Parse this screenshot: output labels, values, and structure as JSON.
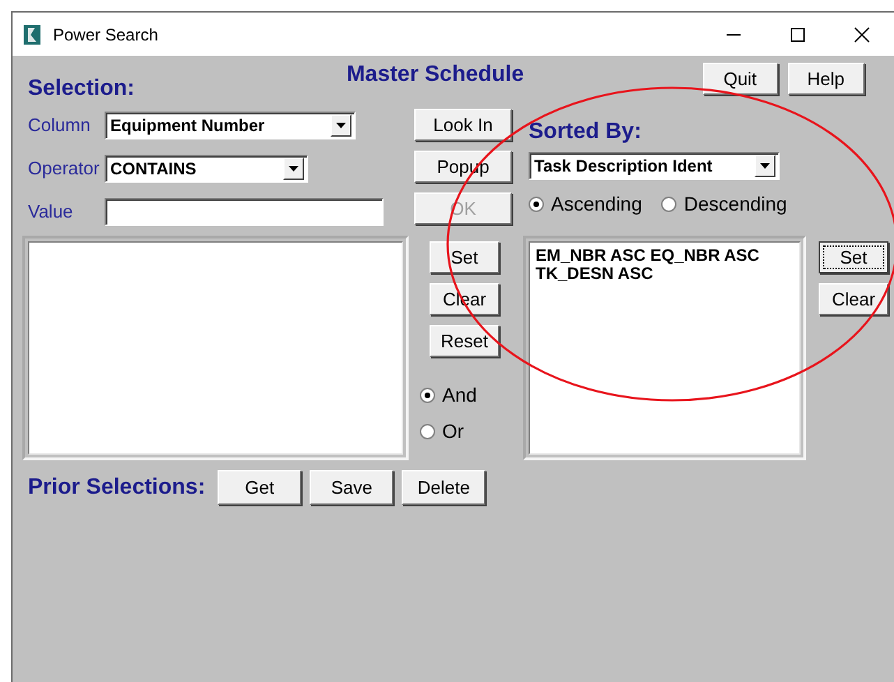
{
  "window": {
    "title": "Power Search"
  },
  "title": "Master Schedule",
  "top_buttons": [
    "Quit",
    "Help"
  ],
  "selection": {
    "heading": "Selection:",
    "fields": [
      {
        "label": "Column",
        "kind": "dropdown",
        "value": "Equipment Number"
      },
      {
        "label": "Operator",
        "kind": "dropdown",
        "value": "CONTAINS"
      },
      {
        "label": "Value",
        "kind": "text"
      }
    ]
  },
  "middle_buttons": [
    {
      "label": "Look In",
      "disabled": false
    },
    {
      "label": "Popup",
      "disabled": false
    },
    {
      "label": "OK",
      "disabled": true
    }
  ],
  "selection_buttons": [
    "Set",
    "Clear",
    "Reset"
  ],
  "combine": [
    {
      "label": "And",
      "selected": true
    },
    {
      "label": "Or",
      "selected": false
    }
  ],
  "sorted_by": {
    "heading": "Sorted By:",
    "dropdown": "Task Description Ident",
    "order": [
      {
        "label": "Ascending",
        "selected": true
      },
      {
        "label": "Descending",
        "selected": false
      }
    ],
    "list": [
      "EM_NBR ASC EQ_NBR ASC TK_DESN ASC"
    ],
    "buttons": [
      {
        "label": "Set",
        "focused": true
      },
      {
        "label": "Clear",
        "focused": false
      }
    ]
  },
  "prior_selections": {
    "heading": "Prior Selections:",
    "buttons": [
      "Get",
      "Save",
      "Delete"
    ]
  }
}
